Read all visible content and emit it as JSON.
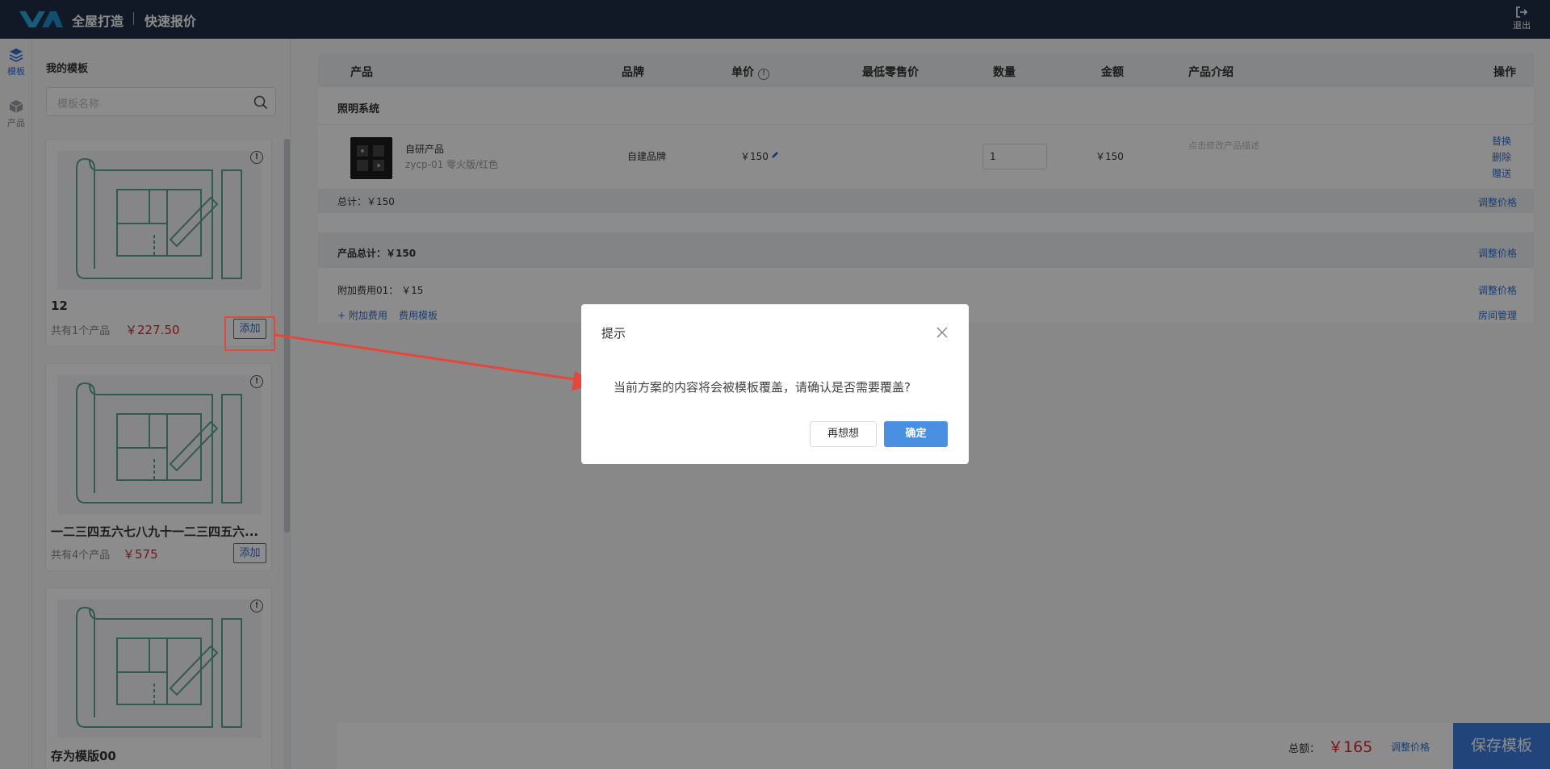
{
  "header": {
    "app_title": "全屋打造",
    "app_subtitle": "快速报价",
    "logout_label": "退出"
  },
  "rail": {
    "items": [
      {
        "label": "模板",
        "icon": "layers-icon",
        "active": true
      },
      {
        "label": "产品",
        "icon": "box-icon",
        "active": false
      }
    ]
  },
  "template_panel": {
    "heading": "我的模板",
    "search_placeholder": "模板名称",
    "add_label": "添加",
    "templates": [
      {
        "name": "12",
        "count": "共有1个产品",
        "price": "￥227.50"
      },
      {
        "name": "一二三四五六七八九十一二三四五六...",
        "count": "共有4个产品",
        "price": "￥575"
      },
      {
        "name": "存为模版00",
        "count": "",
        "price": ""
      }
    ]
  },
  "table": {
    "columns": [
      "产品",
      "品牌",
      "单价",
      "最低零售价",
      "数量",
      "金额",
      "产品介绍",
      "操作"
    ],
    "group_title": "照明系统",
    "rows": [
      {
        "name": "自研产品",
        "spec": "zycp-01 零火版/红色",
        "brand": "自建品牌",
        "price": "￥150",
        "quantity": "1",
        "amount": "￥150",
        "description": "点击修改产品描述",
        "actions": [
          "替换",
          "删除",
          "赠送"
        ]
      }
    ],
    "subtotal": "总计：￥150",
    "adjust_price": "调整价格"
  },
  "summary": {
    "product_total": "产品总计：￥150",
    "extra_fee": "附加费用01：  ￥15",
    "add_extra": "+ 附加费用",
    "fee_template": "费用模板",
    "room_manage": "房间管理",
    "adjust_price": "调整价格"
  },
  "bottom": {
    "total_label": "总额：",
    "total_value": "￥165",
    "adjust_price": "调整价格",
    "save_label": "保存模板"
  },
  "modal": {
    "title": "提示",
    "message": "当前方案的内容将会被模板覆盖，请确认是否需要覆盖?",
    "cancel_label": "再想想",
    "ok_label": "确定"
  },
  "colors": {
    "header_bg": "#1f2d45",
    "accent": "#2f6fd6",
    "price_red": "#e6262a",
    "annotation_red": "#e5473b",
    "primary_button": "#4a90e2"
  }
}
